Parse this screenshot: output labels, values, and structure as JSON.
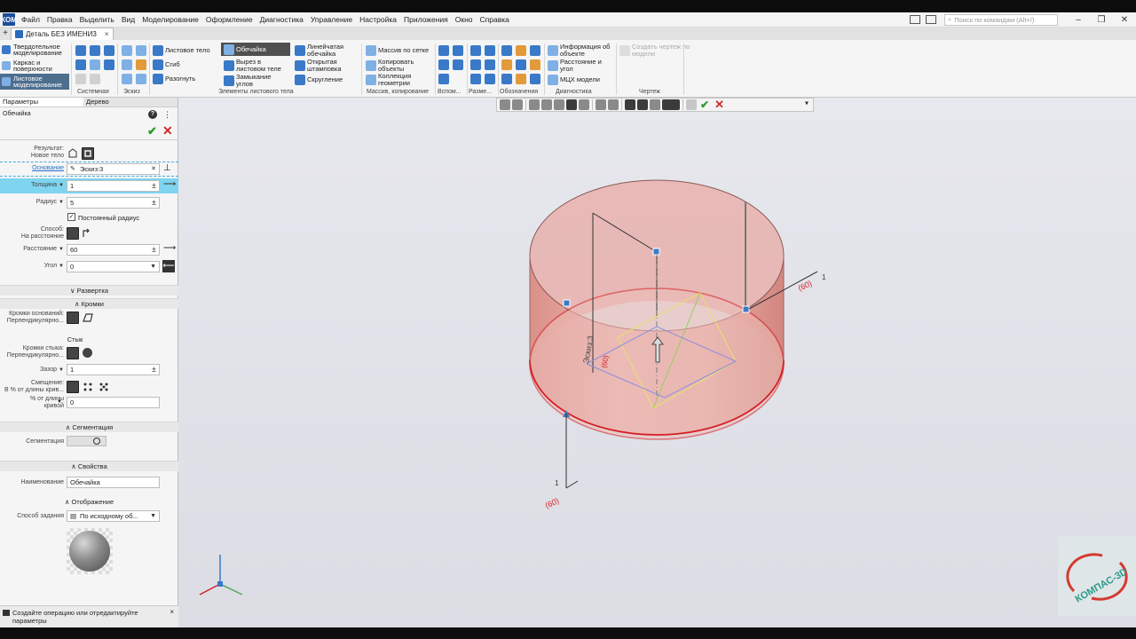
{
  "menu": {
    "app_icon": "КОМ",
    "items": [
      "Файл",
      "Правка",
      "Выделить",
      "Вид",
      "Моделирование",
      "Оформление",
      "Диагностика",
      "Управление",
      "Настройка",
      "Приложения",
      "Окно",
      "Справка"
    ],
    "search_placeholder": "Поиск по командам (Alt+/)",
    "window_controls": {
      "minimize": "–",
      "restore": "❐",
      "close": "✕"
    }
  },
  "tabs": {
    "plus": "+",
    "document": "Деталь БЕЗ ИМЕНИ3",
    "close": "×"
  },
  "ribbon": {
    "modes": [
      "Твердотельное моделирование",
      "Каркас и поверхности",
      "Листовое моделирование"
    ],
    "sheet_body": "Листовое тело",
    "shell": "Обечайка",
    "linear_shell": "Линейчатая обечайка",
    "bend": "Сгиб",
    "cutout": "Вырез в листовом теле",
    "stamp_open": "Открытая штамповка",
    "unbend": "Разогнуть",
    "corner_close": "Замыкание углов",
    "rounding": "Скругление",
    "grid_array": "Массив по сетке",
    "copy_objects": "Копировать объекты",
    "geometry_collection": "Коллекция геометрии",
    "object_info": "Информация об объекте",
    "distance_angle": "Расстояние и угол",
    "mcx_model": "МЦХ модели",
    "create_drawing": "Создать чертеж по модели",
    "groups": [
      "Системная",
      "Эскиз",
      "Элементы листового тела",
      "Массив, копирование",
      "Вспом...",
      "Разме...",
      "Обозначения",
      "Диагностика",
      "Чертеж"
    ]
  },
  "panel": {
    "tab_params": "Параметры",
    "tab_tree": "Дерево",
    "title": "Обечайка",
    "help": "?",
    "ok": "✔",
    "cancel": "✕",
    "result_label_1": "Результат:",
    "result_label_2": "Новое тело",
    "base_label": "Основание",
    "base_value": "Эскиз:3",
    "thickness_label": "Толщина",
    "thickness_value": "1",
    "radius_label": "Радиус",
    "radius_value": "5",
    "const_radius": "Постоянный радиус",
    "method_label_1": "Способ:",
    "method_label_2": "На расстояние",
    "distance_label": "Расстояние",
    "distance_value": "60",
    "angle_label": "Угол",
    "angle_value": "0",
    "sec_unfold": "Развертка",
    "sec_edges": "Кромки",
    "base_edges_1": "Кромки оснований:",
    "base_edges_2": "Перпендикулярно...",
    "joint": "Стык",
    "joint_edges_1": "Кромки стыка:",
    "joint_edges_2": "Перпендикулярно...",
    "gap_label": "Зазор",
    "gap_value": "1",
    "offset_label_1": "Смещение:",
    "offset_label_2": "В % от длины крив...",
    "percent_label_1": "% от длины",
    "percent_label_2": "кривой",
    "percent_value": "0",
    "sec_segmentation": "Сегментация",
    "segmentation_label": "Сегментация",
    "sec_properties": "Свойства",
    "name_label": "Наименование",
    "name_value": "Обечайка",
    "display": "Отображение",
    "spec_method_label": "Способ задания",
    "spec_method_value": "По исходному об...",
    "status_1": "Создайте операцию или отредактируйте",
    "status_2": "параметры",
    "status_close": "×"
  },
  "viewport": {
    "ok": "✔",
    "cancel": "✕",
    "dim_top": "(60)",
    "dim_bottom": "(60)",
    "dim_side": "(60)",
    "sketch_label": "Эскиз:3",
    "thickness_mark": "1",
    "logo_text": "КОМПАС-3D"
  },
  "colors": {
    "shell_fill": "#e4a49e",
    "shell_edge": "#d41f24",
    "accent": "#3a79c7"
  }
}
